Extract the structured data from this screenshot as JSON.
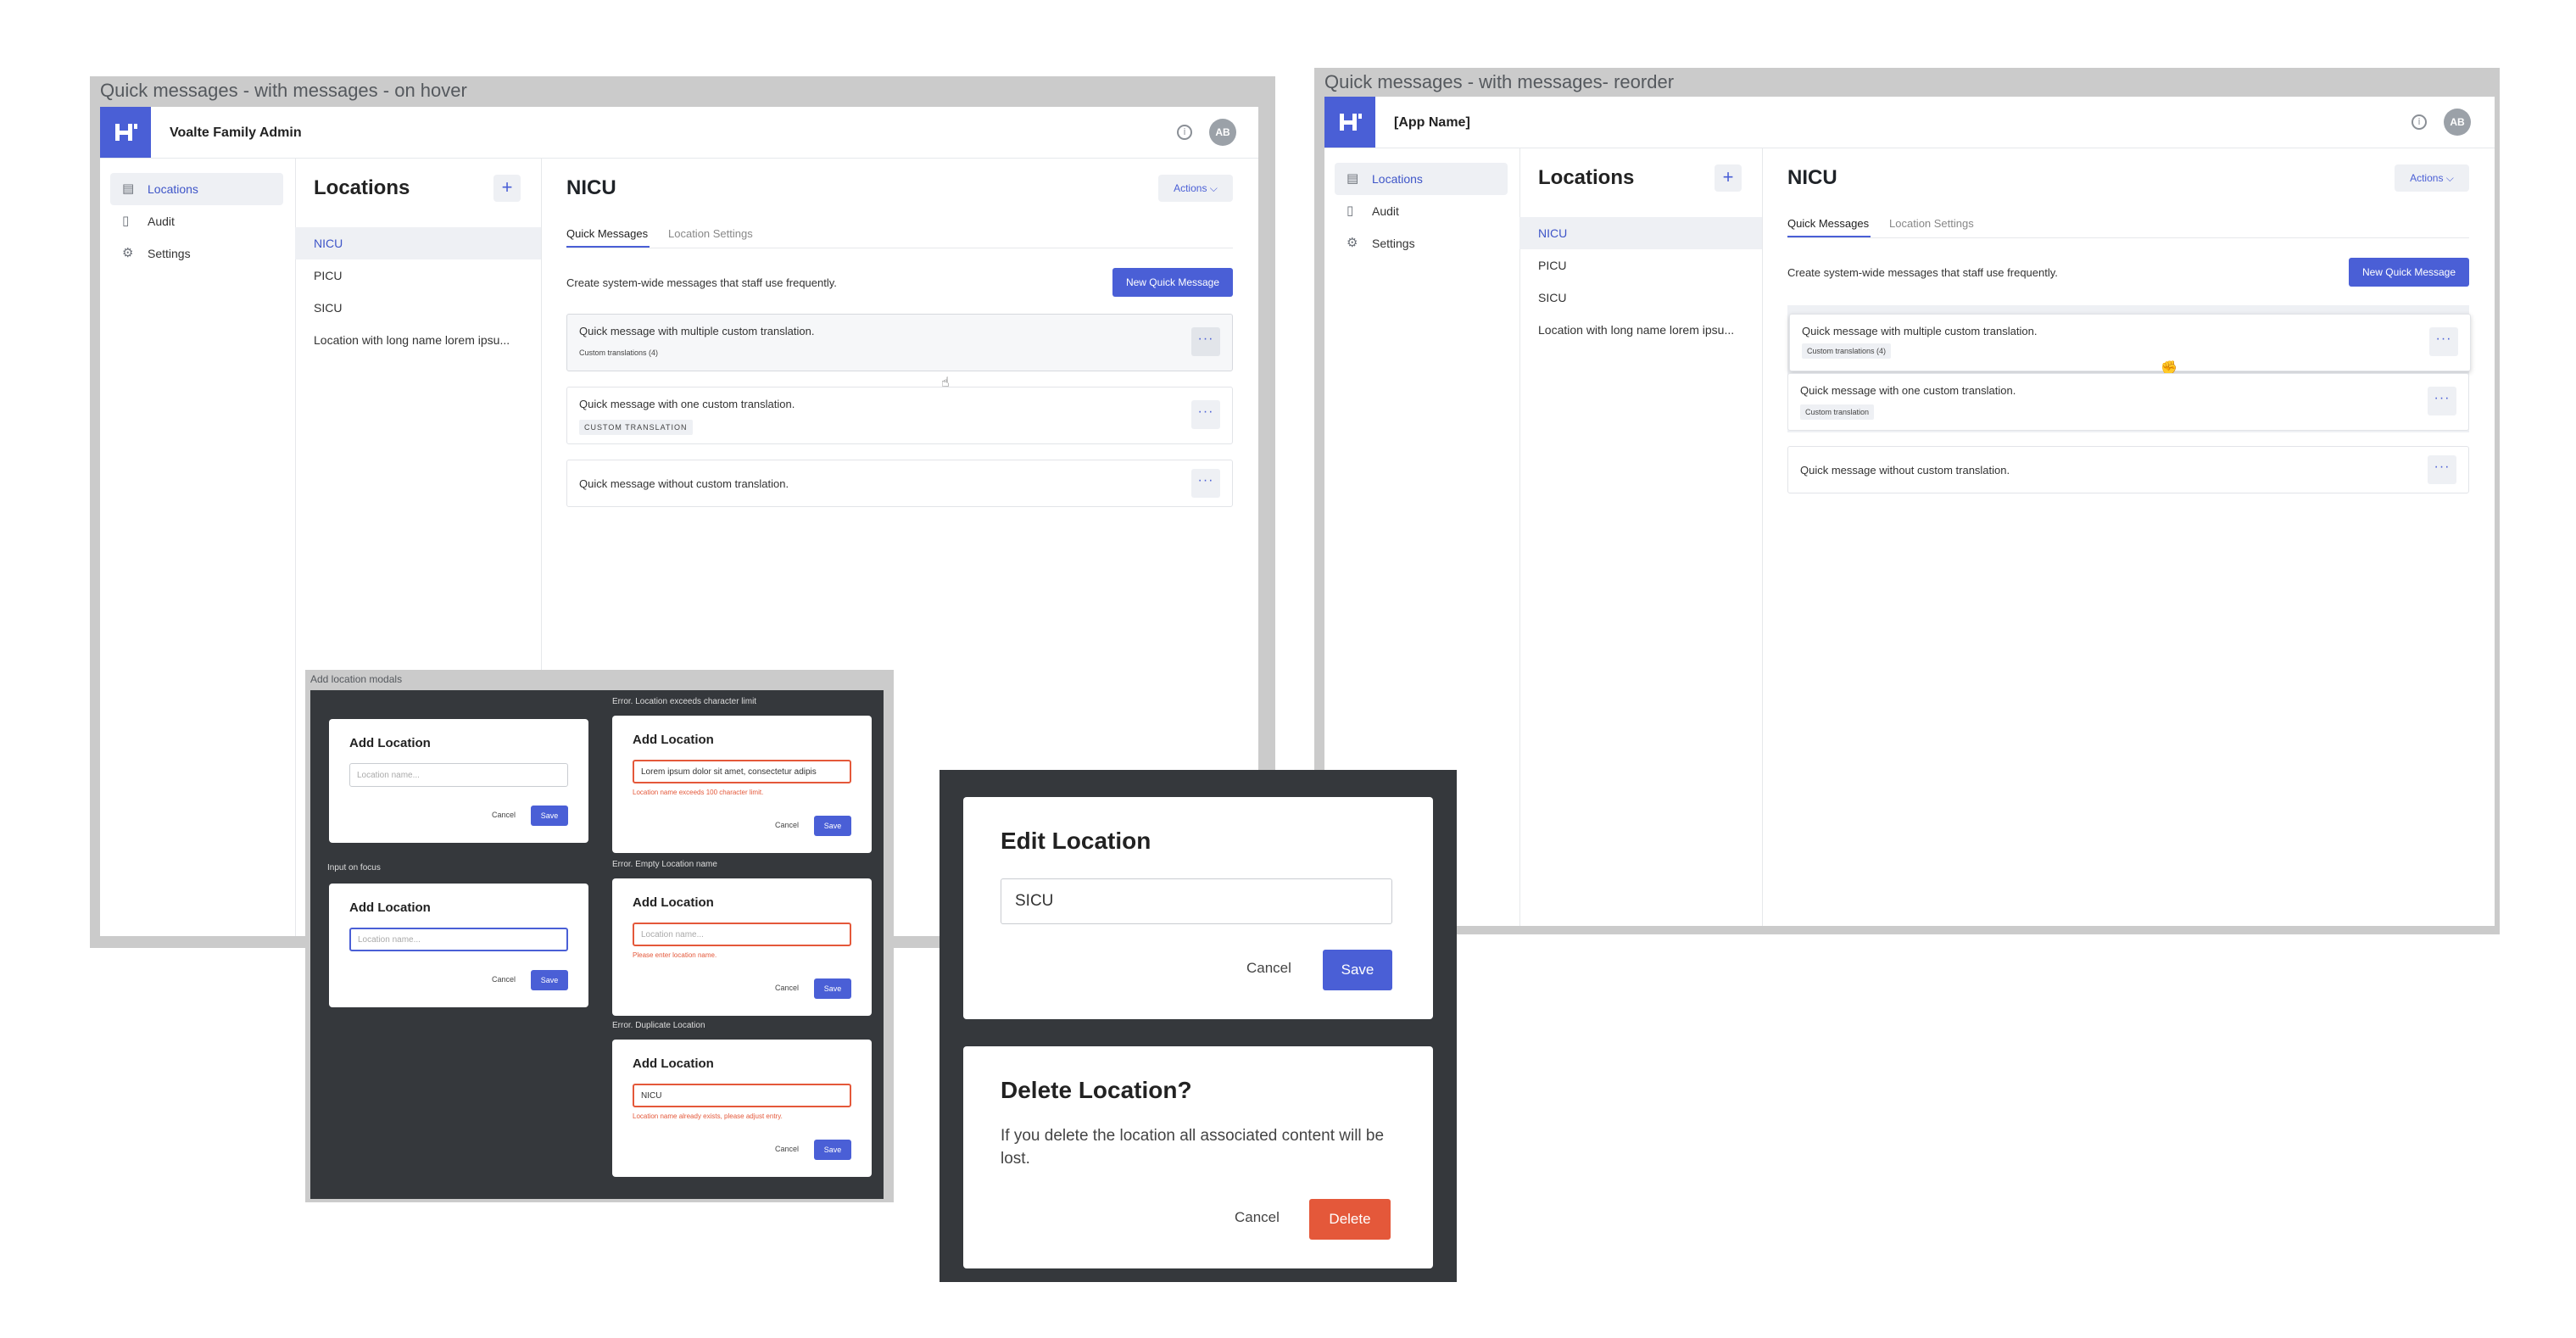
{
  "frames": {
    "hover": {
      "title": "Quick messages - with messages - on hover"
    },
    "reorder": {
      "title": "Quick messages - with messages- reorder"
    },
    "modals": {
      "title": "Add location modals"
    }
  },
  "colors": {
    "accent": "#4a5fd6",
    "error": "#e4583a",
    "dark_bg": "#35383c",
    "frame": "#cbcbcb"
  },
  "app_left": {
    "app_name": "Voalte Family Admin",
    "avatar": "AB",
    "info_icon": "info-icon"
  },
  "app_right": {
    "app_name": "[App Name]",
    "avatar": "AB",
    "info_icon": "info-icon"
  },
  "sidebar": {
    "items": [
      {
        "label": "Locations",
        "icon": "document-icon",
        "active": true
      },
      {
        "label": "Audit",
        "icon": "file-icon",
        "active": false
      },
      {
        "label": "Settings",
        "icon": "gear-icon",
        "active": false
      }
    ]
  },
  "locations": {
    "heading": "Locations",
    "add_label": "+",
    "items": [
      "NICU",
      "PICU",
      "SICU",
      "Location with long name lorem ipsu..."
    ]
  },
  "main": {
    "title": "NICU",
    "actions_label": "Actions ⌵",
    "tabs": [
      "Quick Messages",
      "Location Settings"
    ],
    "description": "Create system-wide messages that staff use frequently.",
    "new_button": "New Quick Message",
    "more_label": "···",
    "messages": [
      {
        "text": "Quick message with multiple custom translation.",
        "badge": "Custom translations (4)"
      },
      {
        "text": "Quick message with one custom translation.",
        "badge_left": "CUSTOM TRANSLATION",
        "badge_right": "Custom translation"
      },
      {
        "text": "Quick message without custom translation."
      }
    ]
  },
  "add_modals": {
    "captions": {
      "focus": "Input on focus",
      "char_limit": "Error. Location exceeds character limit",
      "empty": "Error. Empty Location name",
      "duplicate": "Error. Duplicate Location"
    },
    "title": "Add Location",
    "placeholder": "Location name...",
    "long_value": "Lorem ipsum dolor sit amet, consectetur adipis",
    "duplicate_value": "NICU",
    "errors": {
      "char_limit": "Location name exceeds 100 character limit.",
      "empty": "Please enter location name.",
      "duplicate": "Location name already exists, please adjust entry."
    },
    "cancel": "Cancel",
    "save": "Save"
  },
  "edit_modal": {
    "title": "Edit Location",
    "value": "SICU",
    "cancel": "Cancel",
    "save": "Save"
  },
  "delete_modal": {
    "title": "Delete Location?",
    "body": "If you delete the location all associated content will be lost.",
    "cancel": "Cancel",
    "delete": "Delete"
  }
}
